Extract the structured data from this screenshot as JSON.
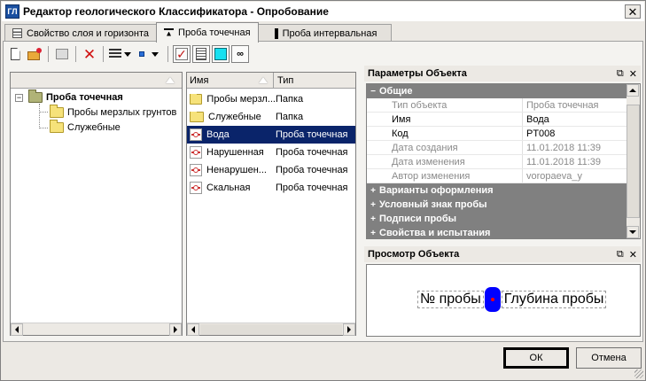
{
  "window": {
    "title": "Редактор геологического Классификатора - Опробование",
    "app_icon_text": "ГЛ"
  },
  "tabs": [
    {
      "label": "Свойство слоя и горизонта",
      "active": false
    },
    {
      "label": "Проба точечная",
      "active": true
    },
    {
      "label": "Проба интервальная",
      "active": false
    }
  ],
  "toolbar": {
    "icons": [
      "new-icon",
      "add-folder-icon",
      "move-up-icon",
      "delete-icon",
      "list-view-icon",
      "point-icon",
      "check-icon",
      "text-icon",
      "color-icon",
      "binoculars-icon"
    ]
  },
  "tree": {
    "root": "Проба точечная",
    "children": [
      "Пробы мерзлых грунтов",
      "Служебные"
    ]
  },
  "list": {
    "columns": [
      "Имя",
      "Тип"
    ],
    "rows": [
      {
        "name": "Пробы мерзл...",
        "type": "Папка",
        "icon": "folder",
        "selected": false
      },
      {
        "name": "Служебные",
        "type": "Папка",
        "icon": "folder",
        "selected": false
      },
      {
        "name": "Вода",
        "type": "Проба точечная",
        "icon": "sample",
        "selected": true
      },
      {
        "name": "Нарушенная",
        "type": "Проба точечная",
        "icon": "sample",
        "selected": false
      },
      {
        "name": "Ненарушен...",
        "type": "Проба точечная",
        "icon": "sample",
        "selected": false
      },
      {
        "name": "Скальная",
        "type": "Проба точечная",
        "icon": "sample",
        "selected": false
      }
    ]
  },
  "properties": {
    "title": "Параметры Объекта",
    "group_general": "Общие",
    "rows": [
      {
        "key": "Тип объекта",
        "value": "Проба точечная",
        "readonly": true
      },
      {
        "key": "Имя",
        "value": "Вода",
        "readonly": false
      },
      {
        "key": "Код",
        "value": "PT008",
        "readonly": false
      },
      {
        "key": "Дата создания",
        "value": "11.01.2018 11:39",
        "readonly": true
      },
      {
        "key": "Дата изменения",
        "value": "11.01.2018 11:39",
        "readonly": true
      },
      {
        "key": "Автор изменения",
        "value": "voropaeva_y",
        "readonly": true
      }
    ],
    "collapsed_groups": [
      "Варианты оформления",
      "Условный знак пробы",
      "Подписи пробы",
      "Свойства и испытания"
    ]
  },
  "preview": {
    "title": "Просмотр Объекта",
    "left_label": "№ пробы",
    "right_label": "Глубина пробы",
    "marker_color": "#0000ff"
  },
  "buttons": {
    "ok": "ОК",
    "cancel": "Отмена"
  }
}
